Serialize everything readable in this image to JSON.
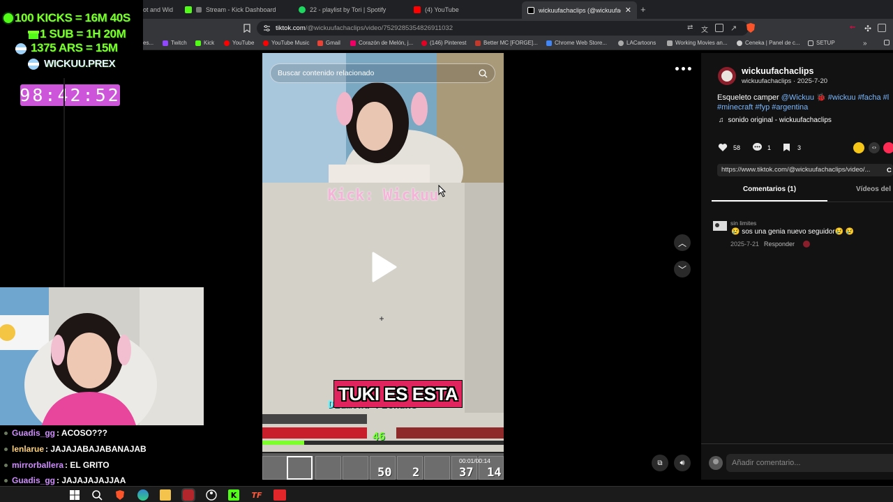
{
  "overlay": {
    "goals": [
      {
        "text": "100 KICKS = 16M 40S"
      },
      {
        "text": "1 SUB = 1H 20M"
      },
      {
        "text": "1375 ARS = 15M"
      },
      {
        "text": "WICKUU.PREX"
      }
    ],
    "timer": "98:42:52"
  },
  "browser": {
    "tabs": [
      {
        "label": "ot and Wid",
        "icon": "tab-icon"
      },
      {
        "label": "Stream - Kick Dashboard",
        "icon": "kick-icon",
        "color": "#53fc18"
      },
      {
        "label": "22 - playlist by Tori | Spotify",
        "icon": "spotify-icon",
        "color": "#1ed760"
      },
      {
        "label": "(4) YouTube",
        "icon": "youtube-icon",
        "color": "#ff0000"
      },
      {
        "label": "wickuufachaclips (@wickuufacha",
        "icon": "tiktok-icon",
        "color": "#ffffff"
      }
    ],
    "url_host": "tiktok.com",
    "url_path": "/@wickuufachaclips/video/7529285354826911032",
    "bookmarks": [
      {
        "label": "es...",
        "color": "#8ab4f8"
      },
      {
        "label": "Twitch",
        "color": "#9146ff"
      },
      {
        "label": "Kick",
        "color": "#53fc18"
      },
      {
        "label": "YouTube",
        "color": "#ff0000"
      },
      {
        "label": "YouTube Music",
        "color": "#ff0000"
      },
      {
        "label": "Gmail",
        "color": "#ea4335"
      },
      {
        "label": "Corazón de Melón, j...",
        "color": "#e06"
      },
      {
        "label": "(146) Pinterest",
        "color": "#e60023"
      },
      {
        "label": "Better MC [FORGE]...",
        "color": "#c0392b"
      },
      {
        "label": "Chrome Web Store...",
        "color": "#4285f4"
      },
      {
        "label": "LACartoons",
        "color": "#aaa"
      },
      {
        "label": "Working Movies an...",
        "color": "#aaa"
      },
      {
        "label": "Ceneka | Panel de c...",
        "color": "#aaa"
      },
      {
        "label": "SETUP",
        "color": "#aaa"
      }
    ]
  },
  "chat": [
    {
      "user": "Guadis_gg",
      "message": ": ACOSO???",
      "color": "#d08cff"
    },
    {
      "user": "lenlarue",
      "message": ": JAJAJABAJABANAJAB",
      "color": "#ffd37a"
    },
    {
      "user": "mirrorballera",
      "message": ": EL GRITO",
      "color": "#d08cff"
    },
    {
      "user": "Guadis_gg",
      "message": ": JAJAJAJAJJAA",
      "color": "#d08cff"
    }
  ],
  "video": {
    "search_placeholder": "Buscar contenido relacionado",
    "stream_tag": "Kick: Wickuu",
    "caption": "TUKI ES ESTA",
    "item_label": "Diamond Pickaxe",
    "xp_level": "46",
    "hotbar_counts": [
      "50",
      "2",
      "37",
      "14"
    ],
    "timecode": "00:01/00:14"
  },
  "panel": {
    "author_display": "wickuufachaclips",
    "author_meta": "wickuufachaclips · 2025-7-20",
    "desc_prefix": "Esqueleto camper ",
    "desc_links": "@Wickuu",
    "desc_tags": "#wickuu #facha #l",
    "desc_tags2": "#minecraft #fyp #argentina",
    "sound": "sonido original - wickuufachaclips",
    "likes": "58",
    "comments": "1",
    "saves": "3",
    "share_url": "https://www.tiktok.com/@wickuufachaclips/video/...",
    "copy_label": "C",
    "tab_comments": "Comentarios (1)",
    "tab_videos": "Vídeos del c",
    "comment": {
      "user": "sin limites",
      "text": "😢 sos una genia nuevo seguidor😢 😢",
      "date": "2025-7-21",
      "reply": "Responder"
    },
    "add_comment_placeholder": "Añadir comentario..."
  }
}
